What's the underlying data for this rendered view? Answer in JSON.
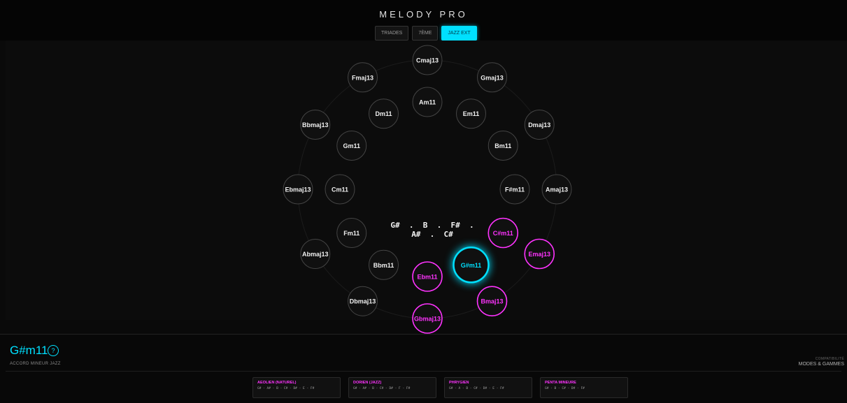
{
  "header": {
    "title": "MELODY PRO"
  },
  "tabs": [
    {
      "label": "TRIADES",
      "active": false
    },
    {
      "label": "7ÈME",
      "active": false
    },
    {
      "label": "JAZZ EXT",
      "active": true
    }
  ],
  "colors": {
    "accent": "#00e0ff",
    "compatible": "#ff33ff",
    "default_ring": "#444444",
    "node_fill": "#101010"
  },
  "wheel": {
    "outer": [
      {
        "label": "Cmaj13",
        "state": "default"
      },
      {
        "label": "Gmaj13",
        "state": "default"
      },
      {
        "label": "Dmaj13",
        "state": "default"
      },
      {
        "label": "Amaj13",
        "state": "default"
      },
      {
        "label": "Emaj13",
        "state": "compatible"
      },
      {
        "label": "Bmaj13",
        "state": "compatible"
      },
      {
        "label": "Gbmaj13",
        "state": "compatible"
      },
      {
        "label": "Dbmaj13",
        "state": "default"
      },
      {
        "label": "Abmaj13",
        "state": "default"
      },
      {
        "label": "Ebmaj13",
        "state": "default"
      },
      {
        "label": "Bbmaj13",
        "state": "default"
      },
      {
        "label": "Fmaj13",
        "state": "default"
      }
    ],
    "inner": [
      {
        "label": "Am11",
        "state": "default"
      },
      {
        "label": "Em11",
        "state": "default"
      },
      {
        "label": "Bm11",
        "state": "default"
      },
      {
        "label": "F#m11",
        "state": "default"
      },
      {
        "label": "C#m11",
        "state": "compatible"
      },
      {
        "label": "G#m11",
        "state": "selected"
      },
      {
        "label": "Ebm11",
        "state": "compatible"
      },
      {
        "label": "Bbm11",
        "state": "default"
      },
      {
        "label": "Fm11",
        "state": "default"
      },
      {
        "label": "Cm11",
        "state": "default"
      },
      {
        "label": "Gm11",
        "state": "default"
      },
      {
        "label": "Dm11",
        "state": "default"
      }
    ],
    "center_notes": "G#  .  B  .  F#  .\nA#  .  C#"
  },
  "selected_chord": {
    "name": "G#m11",
    "help_icon": "help-circle-icon",
    "help_glyph": "?",
    "description": "ACCORD MINEUR JAZZ"
  },
  "compatibility": {
    "caption": "COMPATIBILITÉ",
    "title": "MODES & GAMMES"
  },
  "scales": [
    {
      "name": "AEOLIEN (NATUREL)",
      "notes": "G# - A# - B - C# - D# - E - F#"
    },
    {
      "name": "DORIEN (JAZZ)",
      "notes": "G# - A# - B - C# - D# - F - F#"
    },
    {
      "name": "PHRYGIEN",
      "notes": "G# - A - B - C# - D# - E - F#"
    },
    {
      "name": "PENTA MINEURE",
      "notes": "G# - B - C# - D# - F#"
    }
  ]
}
